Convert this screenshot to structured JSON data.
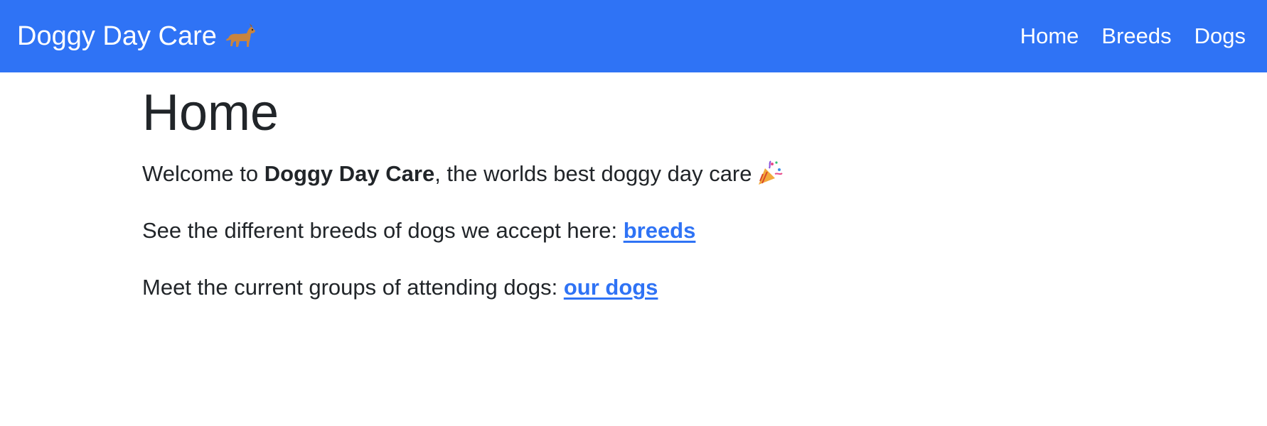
{
  "navbar": {
    "brand_text": "Doggy Day Care",
    "brand_icon": "dog-icon",
    "links": [
      {
        "label": "Home"
      },
      {
        "label": "Breeds"
      },
      {
        "label": "Dogs"
      }
    ],
    "background_color": "#2f73f5"
  },
  "main": {
    "title": "Home",
    "welcome": {
      "prefix": "Welcome to ",
      "bold": "Doggy Day Care",
      "suffix": ", the worlds best doggy day care",
      "icon": "party-popper-icon"
    },
    "breeds_line": {
      "text": "See the different breeds of dogs we accept here: ",
      "link_label": "breeds"
    },
    "dogs_line": {
      "text": "Meet the current groups of attending dogs: ",
      "link_label": "our dogs"
    },
    "link_color": "#2f73f5"
  }
}
